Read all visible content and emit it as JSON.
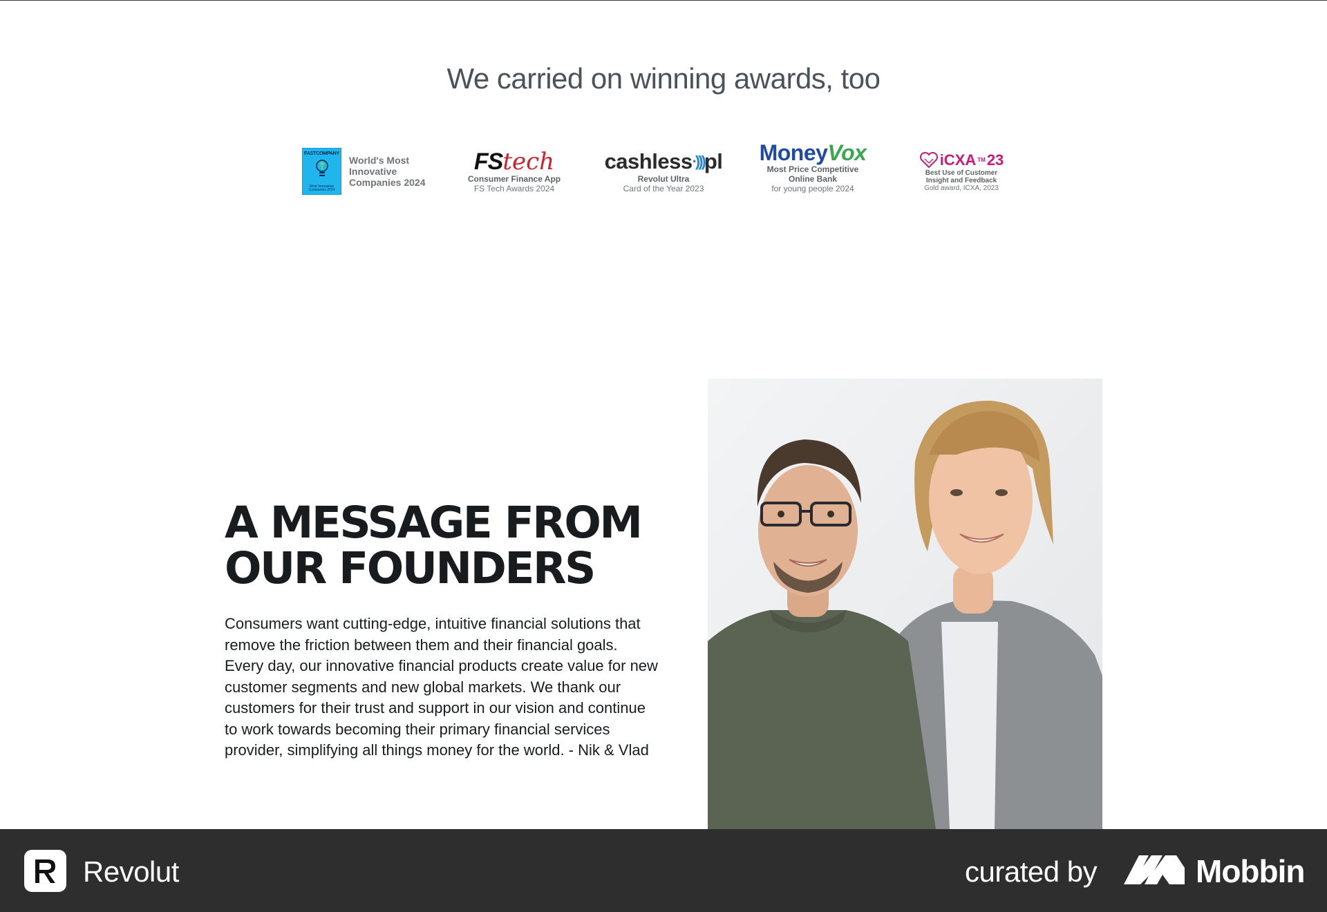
{
  "awards": {
    "title": "We carried on winning awards, too",
    "items": [
      {
        "logo_text": "FASTCOMPANY",
        "badge_text": "Most Innovative Companies 2024",
        "text_lines": [
          "World's Most",
          "Innovative",
          "Companies 2024"
        ]
      },
      {
        "logo_text_1": "FS",
        "logo_text_2": "tech",
        "line1": "Consumer Finance App",
        "line2": "FS Tech Awards 2024"
      },
      {
        "logo_text_1": "cashless",
        "logo_text_2": "pl",
        "line1": "Revolut Ultra",
        "line2": "Card of the Year 2023"
      },
      {
        "logo_text_1": "Money",
        "logo_text_2": "Vox",
        "line1": "Most Price Competitive",
        "line2": "Online Bank",
        "line3": "for young people 2024"
      },
      {
        "logo_text": "iCXA",
        "logo_tm": "TM",
        "logo_year": "23",
        "line1": "Best Use of Customer",
        "line2": "Insight and Feedback",
        "line3": "Gold award, ICXA, 2023"
      }
    ]
  },
  "founders": {
    "headline_line1": "A MESSAGE FROM",
    "headline_line2": "OUR FOUNDERS",
    "message": "Consumers want cutting-edge, intuitive financial solutions that remove the friction between them and their financial goals. Every day, our innovative financial products create value for new customer segments and new global markets. We thank our customers for their trust and support in our vision and continue to work towards becoming their primary financial services provider, simplifying all things money for the world. - Nik & Vlad"
  },
  "footer": {
    "app_name": "Revolut",
    "curated_label": "curated by",
    "brand": "Mobbin"
  },
  "colors": {
    "footer_bg": "#2e2e2e",
    "heading_text": "#191c1f",
    "awards_title": "#4a525a",
    "fstech_red": "#d0202b",
    "moneyvox_blue": "#1f4aa8",
    "moneyvox_green": "#38a84e",
    "icxa_pink": "#c81a79",
    "fastcompany_blue": "#1fb6ee"
  }
}
